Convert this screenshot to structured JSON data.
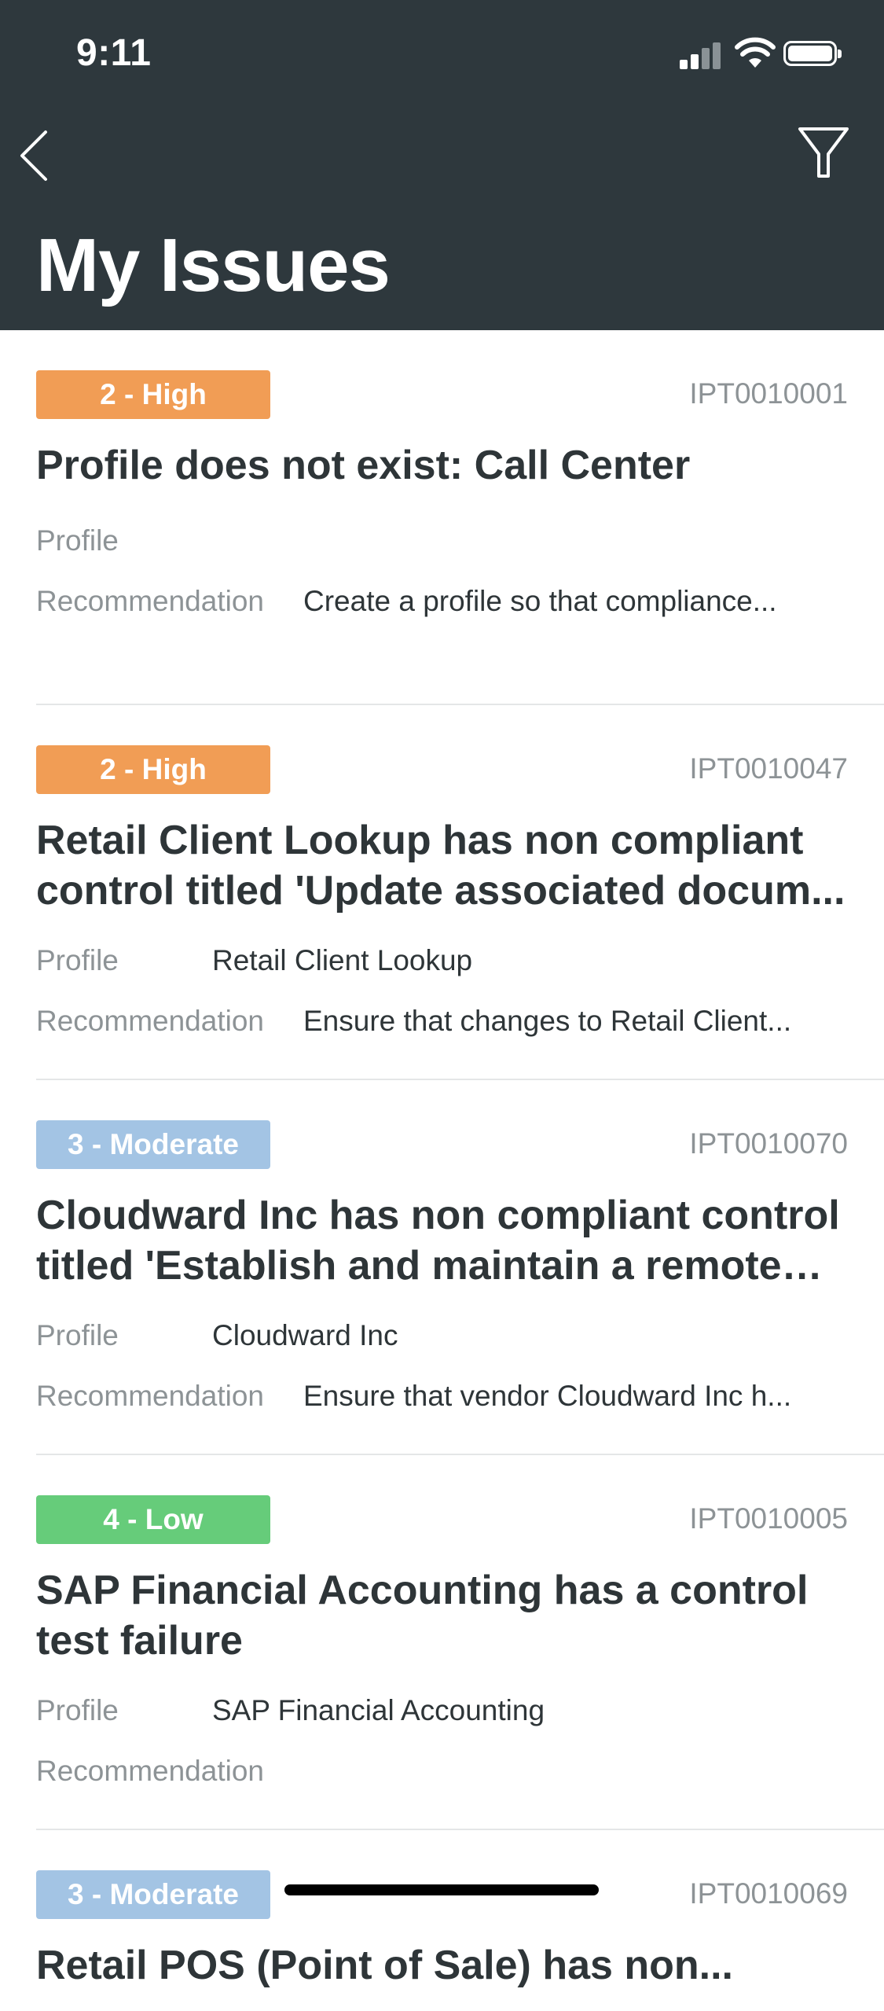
{
  "status_bar": {
    "time": "9:11"
  },
  "header": {
    "title": "My Issues"
  },
  "labels": {
    "profile": "Profile",
    "recommendation": "Recommendation"
  },
  "issues": [
    {
      "severity": "2 - High",
      "severity_color": "#f19d55",
      "id": "IPT0010001",
      "title": "Profile does not exist: Call Center",
      "profile": "",
      "recommendation": "Create a profile so that compliance..."
    },
    {
      "severity": "2 - High",
      "severity_color": "#f19d55",
      "id": "IPT0010047",
      "title": "Retail Client Lookup has non compliant control titled 'Update associated docum...",
      "profile": "Retail Client Lookup",
      "recommendation": "Ensure that changes to Retail Client..."
    },
    {
      "severity": "3 - Moderate",
      "severity_color": "#a3c4e4",
      "id": "IPT0010070",
      "title": "Cloudward Inc has non compliant control titled 'Establish and maintain a remote ac...",
      "profile": "Cloudward Inc",
      "recommendation": "Ensure that vendor Cloudward Inc h..."
    },
    {
      "severity": "4 - Low",
      "severity_color": "#66cc7a",
      "id": "IPT0010005",
      "title": "SAP Financial Accounting has a control test failure",
      "profile": "SAP Financial Accounting",
      "recommendation": ""
    },
    {
      "severity": "3 - Moderate",
      "severity_color": "#a3c4e4",
      "id": "IPT0010069",
      "title": "Retail POS (Point of Sale) has non...",
      "profile": "",
      "recommendation": ""
    }
  ]
}
